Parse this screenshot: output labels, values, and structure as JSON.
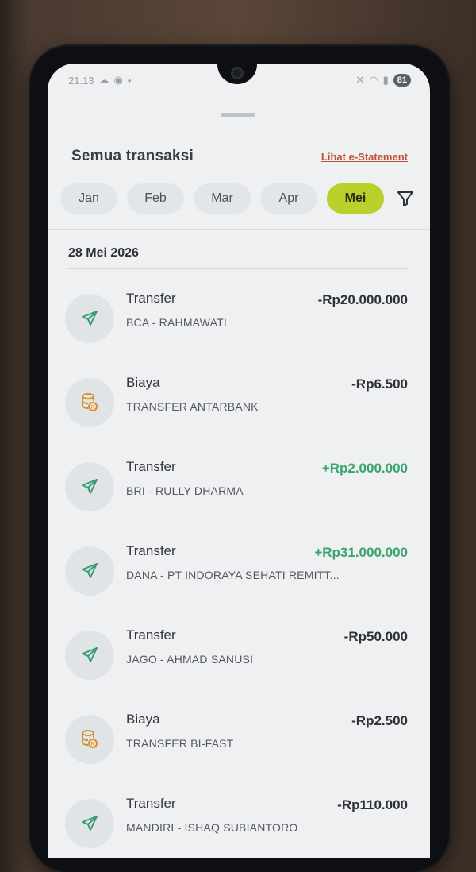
{
  "status_bar": {
    "time": "21.13",
    "battery": "81"
  },
  "header": {
    "title": "Semua transaksi",
    "statement_link": "Lihat e-Statement"
  },
  "months": [
    {
      "label": "Jan",
      "active": false
    },
    {
      "label": "Feb",
      "active": false
    },
    {
      "label": "Mar",
      "active": false
    },
    {
      "label": "Apr",
      "active": false
    },
    {
      "label": "Mei",
      "active": true
    }
  ],
  "icons": {
    "filter": "filter-icon",
    "transfer": "send-icon",
    "fee": "coins-icon"
  },
  "colors": {
    "accent": "#b9d12a",
    "positive": "#3aa36f",
    "fee_icon": "#d4902a",
    "transfer_icon": "#3a9b76"
  },
  "date_group": "28 Mei 2026",
  "transactions": [
    {
      "kind": "transfer",
      "type": "Transfer",
      "desc": "BCA - RAHMAWATI",
      "amount": "-Rp20.000.000",
      "positive": false
    },
    {
      "kind": "fee",
      "type": "Biaya",
      "desc": "TRANSFER ANTARBANK",
      "amount": "-Rp6.500",
      "positive": false
    },
    {
      "kind": "transfer",
      "type": "Transfer",
      "desc": "BRI - RULLY DHARMA",
      "amount": "+Rp2.000.000",
      "positive": true
    },
    {
      "kind": "transfer",
      "type": "Transfer",
      "desc": "DANA - PT INDORAYA SEHATI REMITT...",
      "amount": "+Rp31.000.000",
      "positive": true
    },
    {
      "kind": "transfer",
      "type": "Transfer",
      "desc": "JAGO - AHMAD SANUSI",
      "amount": "-Rp50.000",
      "positive": false
    },
    {
      "kind": "fee",
      "type": "Biaya",
      "desc": "TRANSFER BI-FAST",
      "amount": "-Rp2.500",
      "positive": false
    },
    {
      "kind": "transfer",
      "type": "Transfer",
      "desc": "MANDIRI - ISHAQ SUBIANTORO",
      "amount": "-Rp110.000",
      "positive": false
    }
  ]
}
